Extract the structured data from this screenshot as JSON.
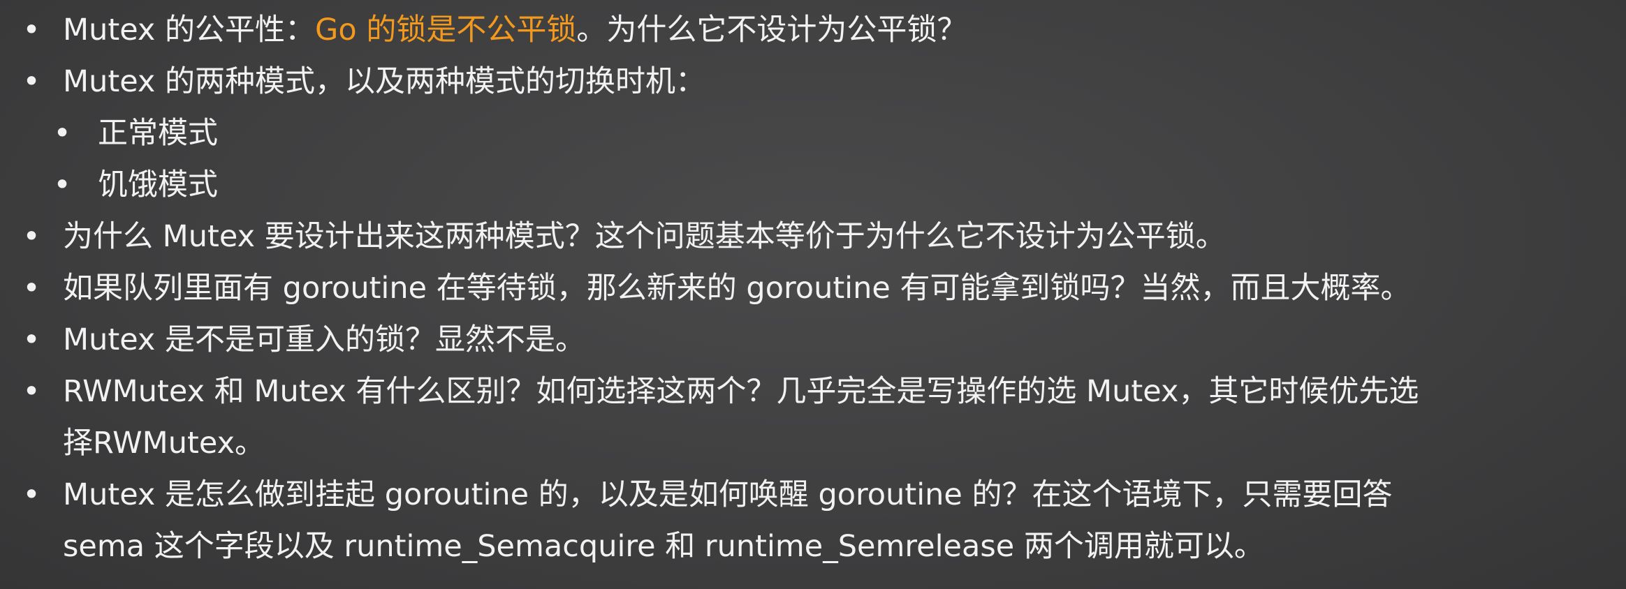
{
  "bullet_glyph": "•",
  "accent_color": "#f39a1e",
  "text_color": "#f2f2f2",
  "bullets": [
    {
      "prefix": "Mutex 的公平性：",
      "highlight": "Go 的锁是不公平锁",
      "suffix": "。为什么它不设计为公平锁？"
    },
    {
      "text": "Mutex 的两种模式，以及两种模式的切换时机："
    },
    {
      "text": "正常模式"
    },
    {
      "text": "饥饿模式"
    },
    {
      "text": "为什么 Mutex 要设计出来这两种模式？这个问题基本等价于为什么它不设计为公平锁。"
    },
    {
      "text": "如果队列里面有 goroutine 在等待锁，那么新来的 goroutine 有可能拿到锁吗？当然，而且大概率。"
    },
    {
      "text": "Mutex 是不是可重入的锁？显然不是。"
    },
    {
      "line1": "RWMutex 和 Mutex 有什么区别？如何选择这两个？几乎完全是写操作的选 Mutex，其它时候优先选",
      "line2": "择RWMutex。"
    },
    {
      "line1": "Mutex 是怎么做到挂起 goroutine 的，以及是如何唤醒 goroutine 的？在这个语境下，只需要回答",
      "line2": "sema 这个字段以及 runtime_Semacquire 和 runtime_Semrelease 两个调用就可以。"
    }
  ]
}
